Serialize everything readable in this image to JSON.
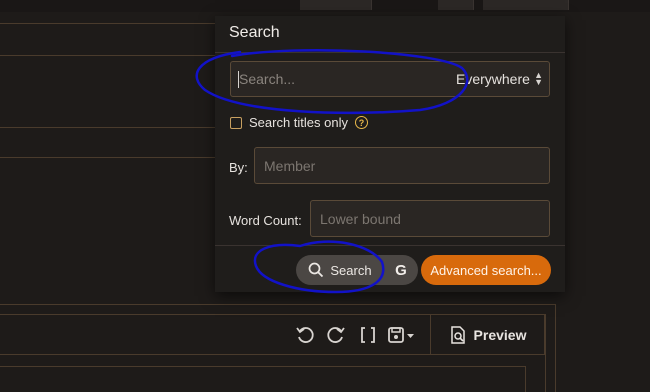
{
  "search_panel": {
    "title": "Search",
    "query_placeholder": "Search...",
    "scope_value": "Everywhere",
    "titles_only_label": "Search titles only",
    "by_label": "By:",
    "member_placeholder": "Member",
    "word_count_label": "Word Count:",
    "lower_bound_placeholder": "Lower bound",
    "search_button": "Search",
    "google_button": "G",
    "advanced_button": "Advanced search..."
  },
  "editor": {
    "preview_label": "Preview"
  },
  "colors": {
    "accent": "#d86a0c",
    "annotation": "#1010c8"
  }
}
